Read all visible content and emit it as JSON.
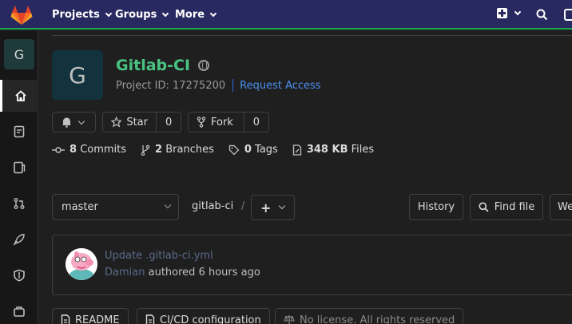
{
  "topbar": {
    "nav": [
      {
        "label": "Projects"
      },
      {
        "label": "Groups"
      },
      {
        "label": "More"
      }
    ],
    "icons": [
      "plus-square-icon",
      "search-icon",
      "issues-icon"
    ]
  },
  "sidebar": {
    "avatar_letter": "G",
    "items": [
      "home-icon",
      "repository-icon",
      "issues-icon",
      "merge-request-icon",
      "rocket-icon",
      "shield-icon",
      "package-icon"
    ]
  },
  "project": {
    "avatar_letter": "G",
    "name": "Gitlab-CI",
    "id_label": "Project ID: 17275200",
    "request_access": "Request Access"
  },
  "actions": {
    "star_label": "Star",
    "star_count": "0",
    "fork_label": "Fork",
    "fork_count": "0"
  },
  "stats": {
    "commits_count": "8",
    "commits_label": "Commits",
    "branches_count": "2",
    "branches_label": "Branches",
    "tags_count": "0",
    "tags_label": "Tags",
    "size_value": "348 KB",
    "size_label": "Files"
  },
  "repo_nav": {
    "branch": "master",
    "path": "gitlab-ci",
    "separator": "/",
    "history_label": "History",
    "find_file_label": "Find file",
    "web_ide_label": "We"
  },
  "commit": {
    "title": "Update .gitlab-ci.yml",
    "author": "Damian",
    "authored_text": "authored",
    "time": "6 hours ago"
  },
  "pills": {
    "readme": "README",
    "cicd": "CI/CD configuration",
    "license": "No license. All rights reserved"
  },
  "colors": {
    "topbar": "#292961",
    "accent_green": "#1aaa55",
    "project_name": "#49c482",
    "link": "#4b8ff0"
  }
}
